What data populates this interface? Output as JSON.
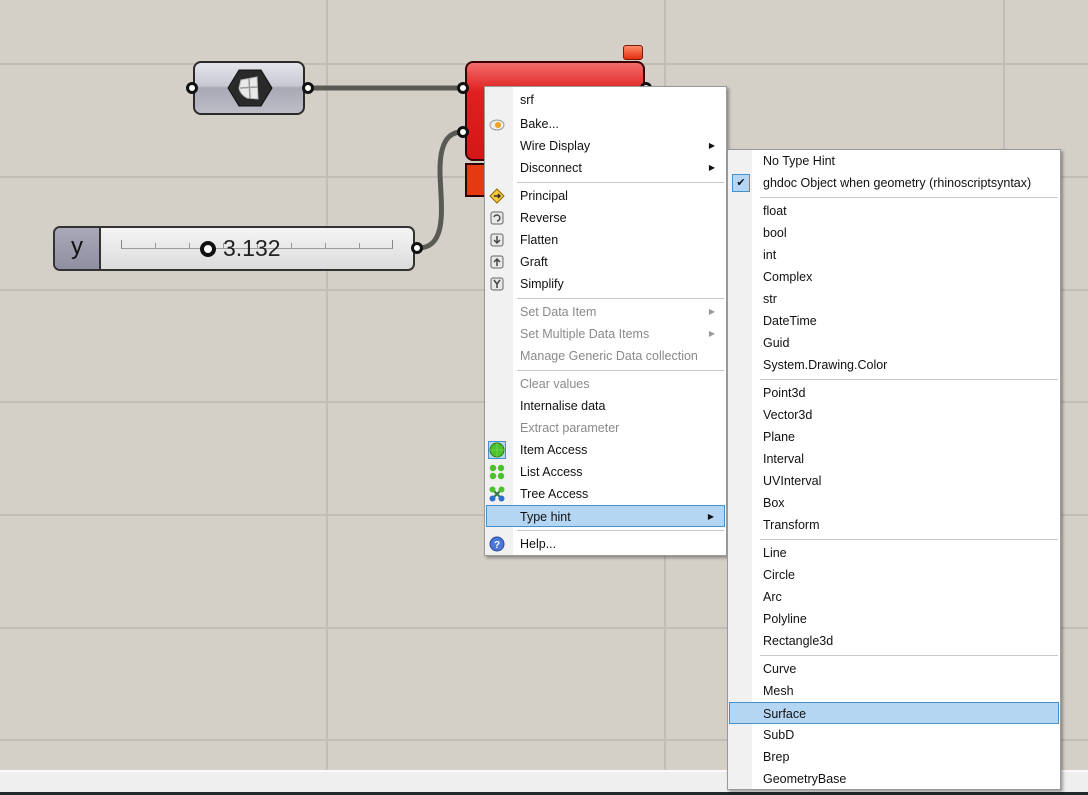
{
  "canvas": {
    "background": "#d4d0c8",
    "grid_color": "#c2beb7"
  },
  "components": {
    "surface_param": {
      "icon": "surface-param-icon"
    },
    "python_script": {
      "color": "#d41616",
      "status": "warning"
    },
    "number_slider": {
      "label": "y",
      "value": "3.132"
    }
  },
  "context_menu": {
    "items": [
      {
        "label": "srf",
        "type": "title"
      },
      {
        "label": "Bake...",
        "icon": "bake-icon"
      },
      {
        "label": "Wire Display",
        "submenu": true
      },
      {
        "label": "Disconnect",
        "submenu": true
      },
      {
        "label": "Principal",
        "icon": "principal-icon"
      },
      {
        "label": "Reverse",
        "icon": "reverse-icon"
      },
      {
        "label": "Flatten",
        "icon": "flatten-icon"
      },
      {
        "label": "Graft",
        "icon": "graft-icon"
      },
      {
        "label": "Simplify",
        "icon": "simplify-icon"
      },
      {
        "label": "Set Data Item",
        "submenu": true,
        "disabled": true
      },
      {
        "label": "Set Multiple Data Items",
        "submenu": true,
        "disabled": true
      },
      {
        "label": "Manage Generic Data collection",
        "disabled": true
      },
      {
        "label": "Clear values",
        "disabled": true
      },
      {
        "label": "Internalise data"
      },
      {
        "label": "Extract parameter",
        "disabled": true
      },
      {
        "label": "Item Access",
        "icon": "item-access-icon",
        "checked": true
      },
      {
        "label": "List Access",
        "icon": "list-access-icon"
      },
      {
        "label": "Tree Access",
        "icon": "tree-access-icon"
      },
      {
        "label": "Type hint",
        "submenu": true,
        "highlighted": true
      },
      {
        "label": "Help...",
        "icon": "help-icon"
      }
    ]
  },
  "type_hint_menu": {
    "items": [
      {
        "label": "No Type Hint"
      },
      {
        "label": "ghdoc Object when geometry (rhinoscriptsyntax)",
        "checked": true
      },
      {
        "label": "float"
      },
      {
        "label": "bool"
      },
      {
        "label": "int"
      },
      {
        "label": "Complex"
      },
      {
        "label": "str"
      },
      {
        "label": "DateTime"
      },
      {
        "label": "Guid"
      },
      {
        "label": "System.Drawing.Color"
      },
      {
        "label": "Point3d"
      },
      {
        "label": "Vector3d"
      },
      {
        "label": "Plane"
      },
      {
        "label": "Interval"
      },
      {
        "label": "UVInterval"
      },
      {
        "label": "Box"
      },
      {
        "label": "Transform"
      },
      {
        "label": "Line"
      },
      {
        "label": "Circle"
      },
      {
        "label": "Arc"
      },
      {
        "label": "Polyline"
      },
      {
        "label": "Rectangle3d"
      },
      {
        "label": "Curve"
      },
      {
        "label": "Mesh"
      },
      {
        "label": "Surface",
        "highlighted": true
      },
      {
        "label": "SubD"
      },
      {
        "label": "Brep"
      },
      {
        "label": "GeometryBase"
      }
    ],
    "check_glyph": "✔",
    "arrow_glyph": "▶"
  }
}
